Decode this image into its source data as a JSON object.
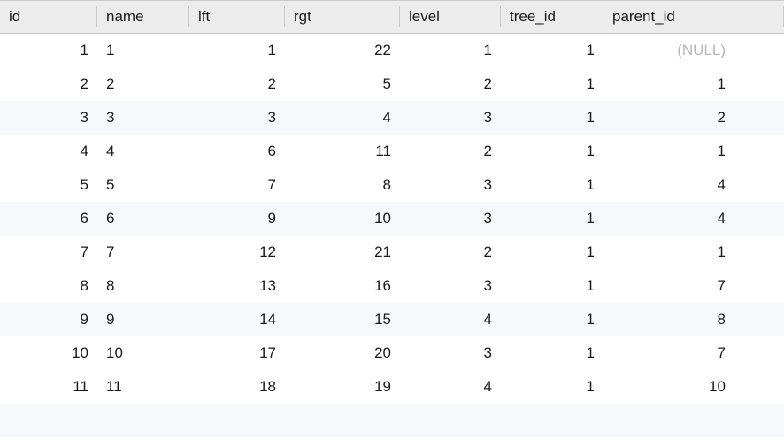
{
  "table": {
    "columns": [
      {
        "key": "id",
        "label": "id",
        "align": "num"
      },
      {
        "key": "name",
        "label": "name",
        "align": "text"
      },
      {
        "key": "lft",
        "label": "lft",
        "align": "num"
      },
      {
        "key": "rgt",
        "label": "rgt",
        "align": "num"
      },
      {
        "key": "level",
        "label": "level",
        "align": "num"
      },
      {
        "key": "tree_id",
        "label": "tree_id",
        "align": "num"
      },
      {
        "key": "parent_id",
        "label": "parent_id",
        "align": "num"
      }
    ],
    "null_text": "(NULL)",
    "rows": [
      {
        "id": 1,
        "name": "1",
        "lft": 1,
        "rgt": 22,
        "level": 1,
        "tree_id": 1,
        "parent_id": null
      },
      {
        "id": 2,
        "name": "2",
        "lft": 2,
        "rgt": 5,
        "level": 2,
        "tree_id": 1,
        "parent_id": 1
      },
      {
        "id": 3,
        "name": "3",
        "lft": 3,
        "rgt": 4,
        "level": 3,
        "tree_id": 1,
        "parent_id": 2
      },
      {
        "id": 4,
        "name": "4",
        "lft": 6,
        "rgt": 11,
        "level": 2,
        "tree_id": 1,
        "parent_id": 1
      },
      {
        "id": 5,
        "name": "5",
        "lft": 7,
        "rgt": 8,
        "level": 3,
        "tree_id": 1,
        "parent_id": 4
      },
      {
        "id": 6,
        "name": "6",
        "lft": 9,
        "rgt": 10,
        "level": 3,
        "tree_id": 1,
        "parent_id": 4
      },
      {
        "id": 7,
        "name": "7",
        "lft": 12,
        "rgt": 21,
        "level": 2,
        "tree_id": 1,
        "parent_id": 1
      },
      {
        "id": 8,
        "name": "8",
        "lft": 13,
        "rgt": 16,
        "level": 3,
        "tree_id": 1,
        "parent_id": 7
      },
      {
        "id": 9,
        "name": "9",
        "lft": 14,
        "rgt": 15,
        "level": 4,
        "tree_id": 1,
        "parent_id": 8
      },
      {
        "id": 10,
        "name": "10",
        "lft": 17,
        "rgt": 20,
        "level": 3,
        "tree_id": 1,
        "parent_id": 7
      },
      {
        "id": 11,
        "name": "11",
        "lft": 18,
        "rgt": 19,
        "level": 4,
        "tree_id": 1,
        "parent_id": 10
      }
    ],
    "alt_rows": [
      2,
      5,
      8
    ]
  }
}
